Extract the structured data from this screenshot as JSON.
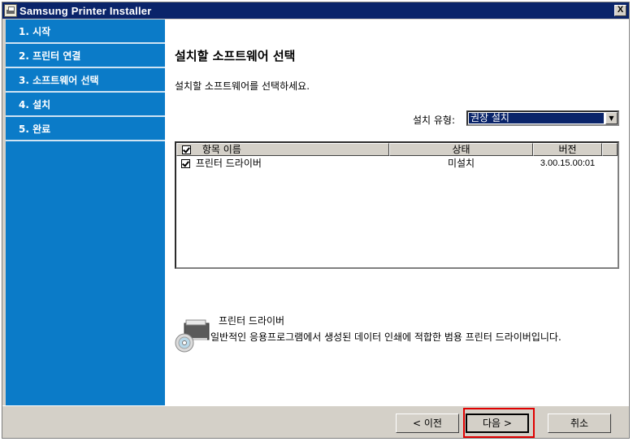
{
  "window": {
    "title": "Samsung Printer Installer",
    "close_label": "X"
  },
  "sidebar": {
    "steps": [
      {
        "label": "1. 시작"
      },
      {
        "label": "2. 프린터 연결"
      },
      {
        "label": "3. 소프트웨어 선택"
      },
      {
        "label": "4. 설치"
      },
      {
        "label": "5. 완료"
      }
    ]
  },
  "main": {
    "heading": "설치할 소프트웨어 선택",
    "subheading": "설치할 소프트웨어를 선택하세요.",
    "install_type": {
      "label": "설치 유형:",
      "value": "권장 설치"
    },
    "list": {
      "columns": [
        "항목 이름",
        "상태",
        "버전"
      ],
      "rows": [
        {
          "name": "프린터 드라이버",
          "status": "미설치",
          "version": "3.00.15.00:01",
          "checked": true
        }
      ]
    },
    "description": {
      "title": "프린터 드라이버",
      "text": "일반적인 응용프로그램에서 생성된 데이터 인쇄에 적합한 범용 프린터 드라이버입니다."
    }
  },
  "buttons": {
    "back": "< 이전",
    "next": "다음 >",
    "cancel": "취소"
  },
  "colors": {
    "sidebar": "#0b7bc8",
    "titlebar": "#0a246a",
    "highlight": "#e00000"
  }
}
